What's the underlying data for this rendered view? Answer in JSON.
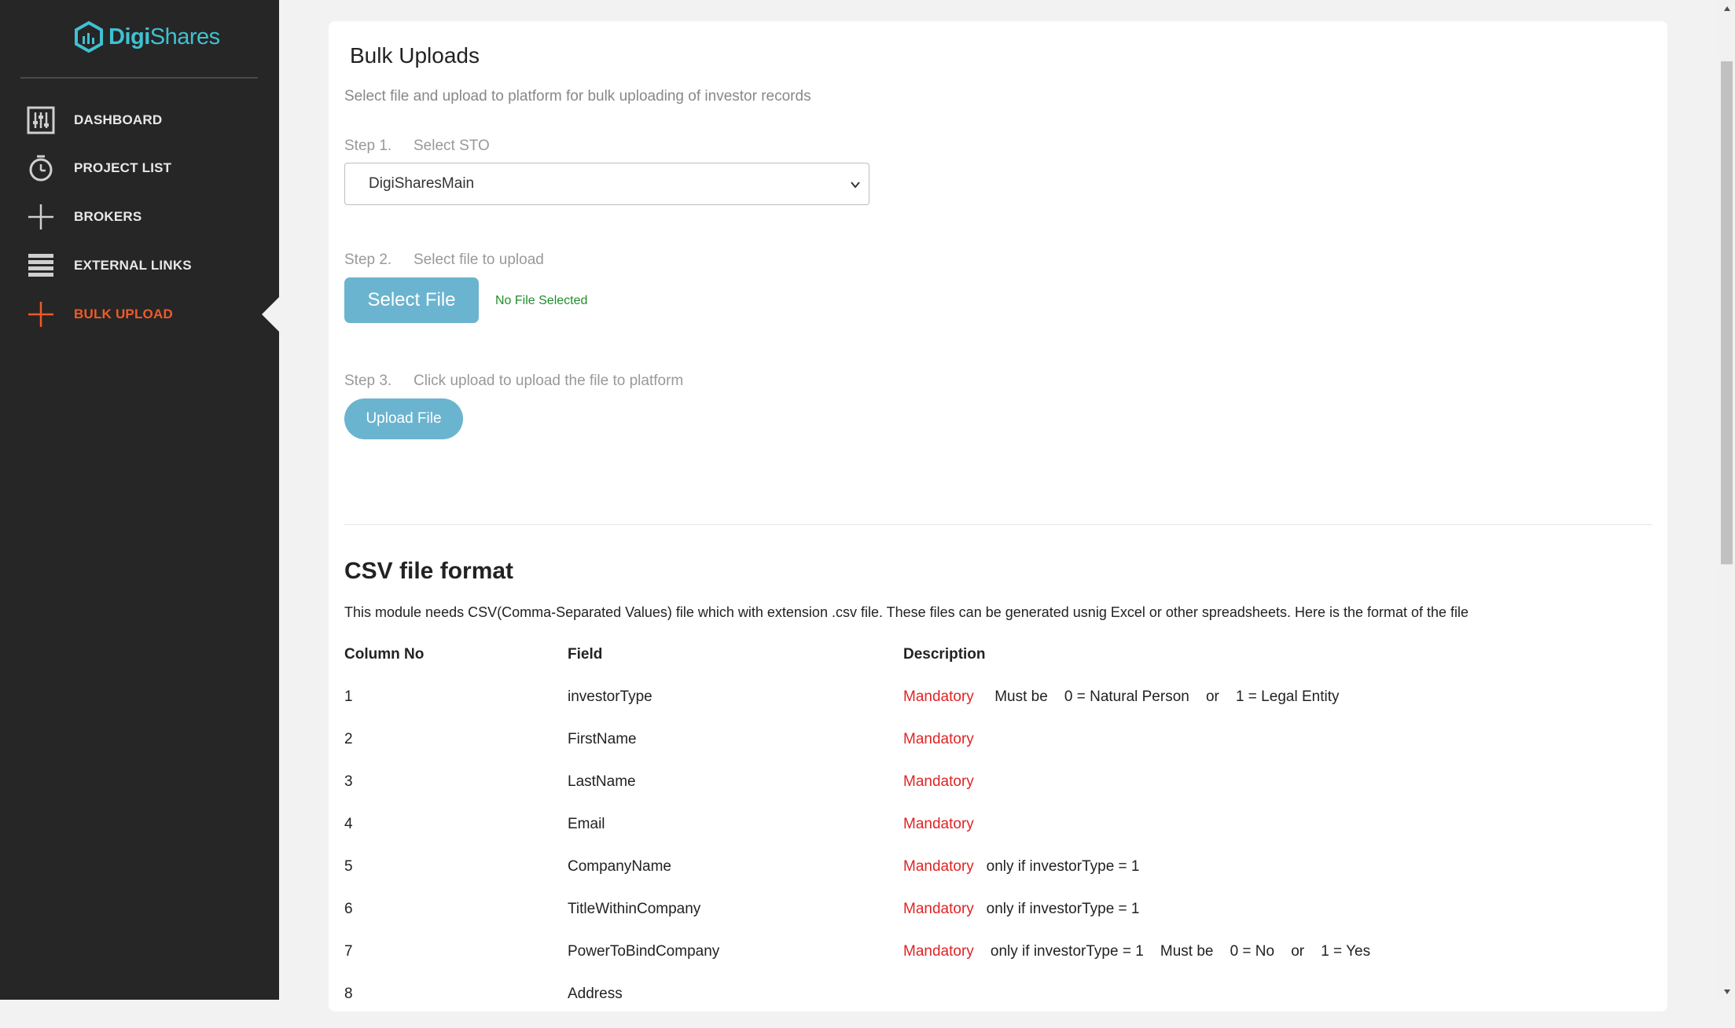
{
  "brand": {
    "name_part1": "Digi",
    "name_part2": "Shares",
    "accent_color": "#3fc1d2"
  },
  "sidebar": {
    "items": [
      {
        "label": "DASHBOARD",
        "icon": "sliders-icon",
        "active": false
      },
      {
        "label": "PROJECT LIST",
        "icon": "stopwatch-icon",
        "active": false
      },
      {
        "label": "BROKERS",
        "icon": "plus-icon",
        "active": false
      },
      {
        "label": "EXTERNAL LINKS",
        "icon": "list-icon",
        "active": false
      },
      {
        "label": "BULK UPLOAD",
        "icon": "plus-icon",
        "active": true
      }
    ],
    "active_color": "#f05a28"
  },
  "page": {
    "title": "Bulk Uploads",
    "subtitle": "Select file and upload to platform for bulk uploading of investor records"
  },
  "steps": {
    "step1": {
      "num": "Step 1.",
      "label": "Select STO",
      "selected": "DigiSharesMain"
    },
    "step2": {
      "num": "Step 2.",
      "label": "Select file to upload",
      "button": "Select File",
      "file_status": "No File Selected"
    },
    "step3": {
      "num": "Step 3.",
      "label": "Click upload to upload the file to platform",
      "button": "Upload File"
    }
  },
  "csv": {
    "title": "CSV file format",
    "description": "This module needs CSV(Comma-Separated Values) file which with extension .csv file. These files can be generated usnig Excel or other spreadsheets. Here is the format of the file",
    "headers": {
      "column_no": "Column No",
      "field": "Field",
      "description": "Description"
    },
    "rows": [
      {
        "no": "1",
        "field": "investorType",
        "mandatory": "Mandatory",
        "note": "Must be    0 = Natural Person    or    1 = Legal Entity"
      },
      {
        "no": "2",
        "field": "FirstName",
        "mandatory": "Mandatory",
        "note": ""
      },
      {
        "no": "3",
        "field": "LastName",
        "mandatory": "Mandatory",
        "note": ""
      },
      {
        "no": "4",
        "field": "Email",
        "mandatory": "Mandatory",
        "note": ""
      },
      {
        "no": "5",
        "field": "CompanyName",
        "mandatory": "Mandatory",
        "note": "only if investorType = 1"
      },
      {
        "no": "6",
        "field": "TitleWithinCompany",
        "mandatory": "Mandatory",
        "note": "only if investorType = 1"
      },
      {
        "no": "7",
        "field": "PowerToBindCompany",
        "mandatory": "Mandatory",
        "note": "only if investorType = 1    Must be    0 = No    or    1 = Yes"
      },
      {
        "no": "8",
        "field": "Address",
        "mandatory": "",
        "note": ""
      }
    ]
  }
}
